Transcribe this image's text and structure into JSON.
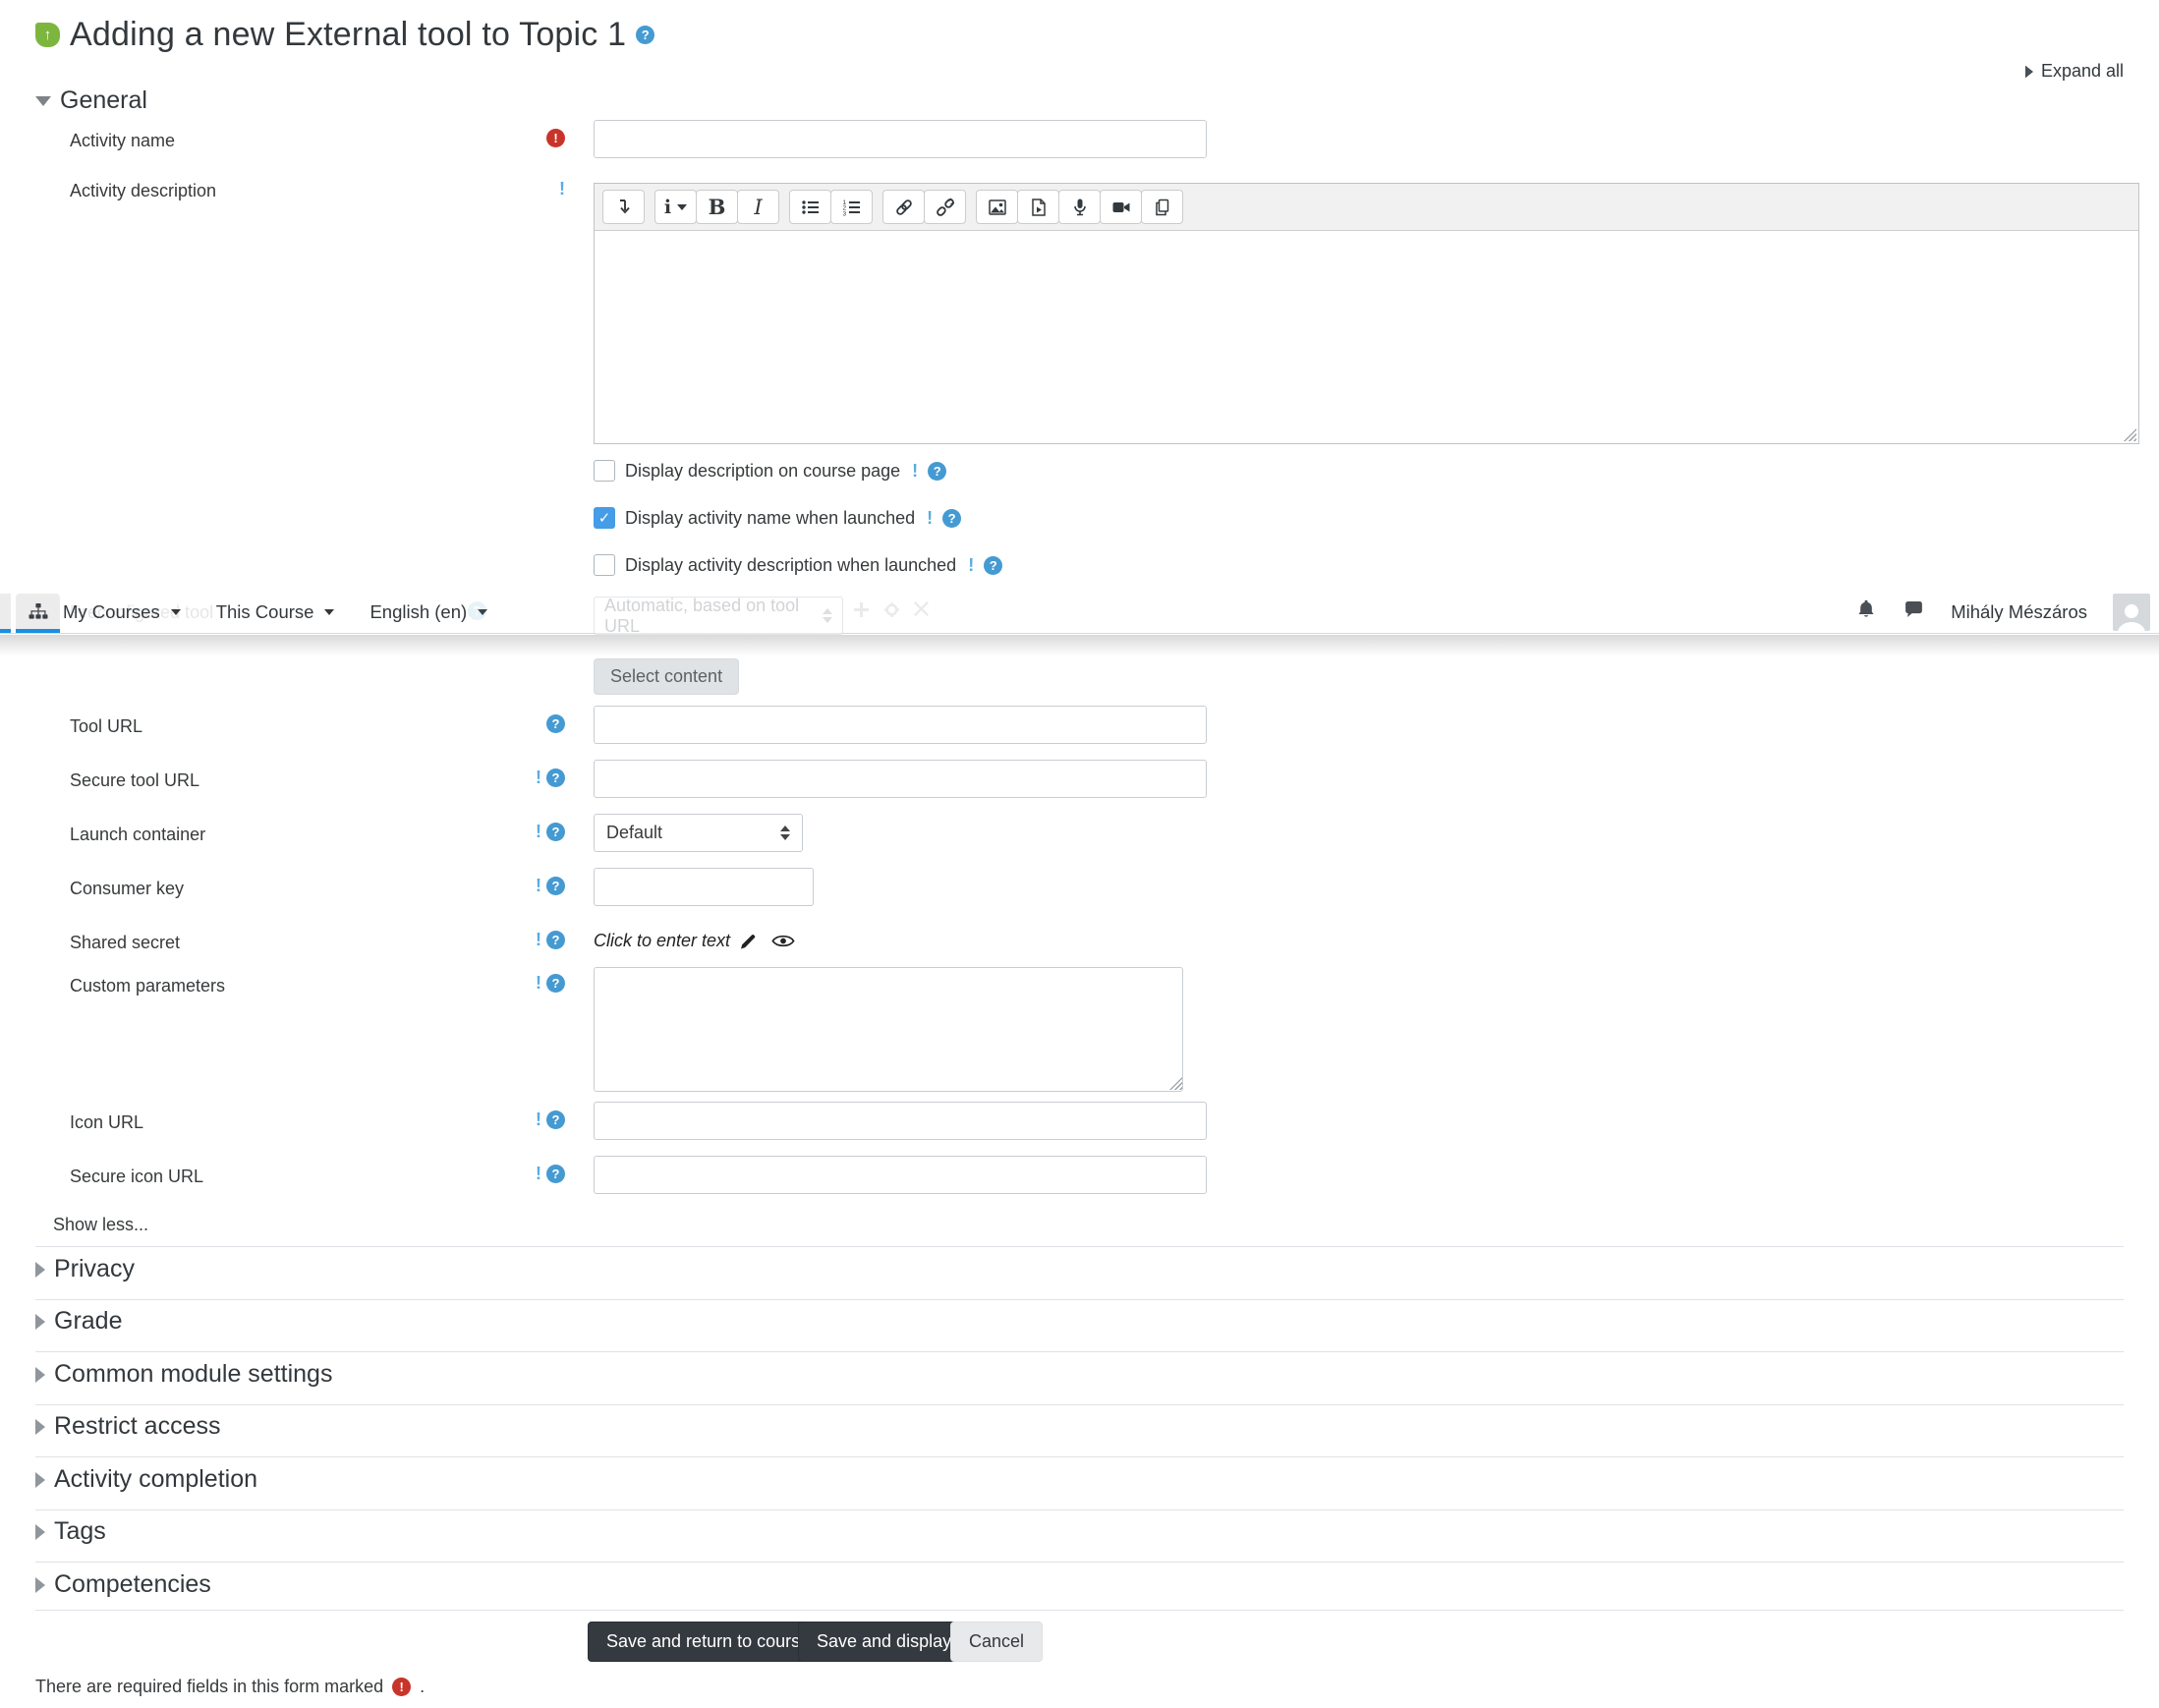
{
  "glyphs": {
    "help": "?",
    "required": "!",
    "advanced": "!",
    "check": "✓",
    "arrow_up": "↑"
  },
  "header": {
    "title": "Adding a new External tool to Topic 1",
    "expand_all": "Expand all"
  },
  "navbar": {
    "items": [
      "My Courses",
      "This Course",
      "English (en)"
    ],
    "user_name": "Mihály Mészáros"
  },
  "editor": {
    "style_letter": "i",
    "bold": "B",
    "italic": "I"
  },
  "form": {
    "general_heading": "General",
    "activity_name_label": "Activity name",
    "activity_description_label": "Activity description",
    "checkboxes": [
      {
        "label": "Display description on course page",
        "checked": false
      },
      {
        "label": "Display activity name when launched",
        "checked": true
      },
      {
        "label": "Display activity description when launched",
        "checked": false
      }
    ],
    "preconfigured": {
      "label": "Preconfigured tool",
      "value": "Automatic, based on tool URL"
    },
    "select_content_button": "Select content",
    "tool_url_label": "Tool URL",
    "secure_tool_url_label": "Secure tool URL",
    "launch_container": {
      "label": "Launch container",
      "value": "Default"
    },
    "consumer_key_label": "Consumer key",
    "shared_secret": {
      "label": "Shared secret",
      "value": "Click to enter text"
    },
    "custom_parameters_label": "Custom parameters",
    "icon_url_label": "Icon URL",
    "secure_icon_url_label": "Secure icon URL",
    "show_less": "Show less...",
    "sections": [
      "Privacy",
      "Grade",
      "Common module settings",
      "Restrict access",
      "Activity completion",
      "Tags",
      "Competencies"
    ],
    "buttons": {
      "save_return": "Save and return to course",
      "save_display": "Save and display",
      "cancel": "Cancel"
    },
    "required_note": {
      "text": "There are required fields in this form marked",
      "suffix": "."
    }
  },
  "colors": {
    "accent_blue": "#1a8fe3",
    "help_blue": "#459ad2",
    "required_red": "#c9342a",
    "checkbox_blue": "#459ce7",
    "tool_green": "#7db63e",
    "dark_button": "#343a40"
  }
}
